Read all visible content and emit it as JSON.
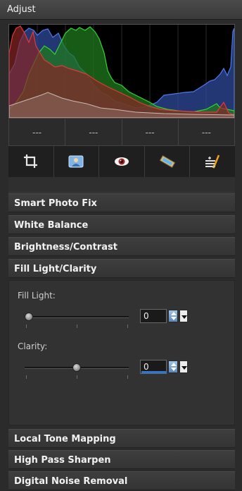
{
  "panel": {
    "title": "Adjust"
  },
  "histogram": {
    "readouts": [
      "---",
      "---",
      "---",
      "---"
    ]
  },
  "toolbar": {
    "tools": [
      {
        "name": "crop-icon"
      },
      {
        "name": "photo-fix-icon"
      },
      {
        "name": "red-eye-icon"
      },
      {
        "name": "straighten-icon"
      },
      {
        "name": "makeover-icon"
      }
    ]
  },
  "sections": {
    "smart_photo_fix": "Smart Photo Fix",
    "white_balance": "White Balance",
    "brightness_contrast": "Brightness/Contrast",
    "fill_light_clarity": "Fill Light/Clarity",
    "local_tone_mapping": "Local Tone Mapping",
    "high_pass_sharpen": "High Pass Sharpen",
    "digital_noise_removal": "Digital Noise Removal"
  },
  "fill_light": {
    "label": "Fill Light:",
    "value": "0",
    "slider_fraction": 0
  },
  "clarity": {
    "label": "Clarity:",
    "value": "0",
    "slider_fraction": 0.5
  },
  "colors": {
    "accent_blue": "#2f75d1",
    "hist_red": "#e23b3b",
    "hist_green": "#2ecc40",
    "hist_blue": "#3b6fe0"
  }
}
